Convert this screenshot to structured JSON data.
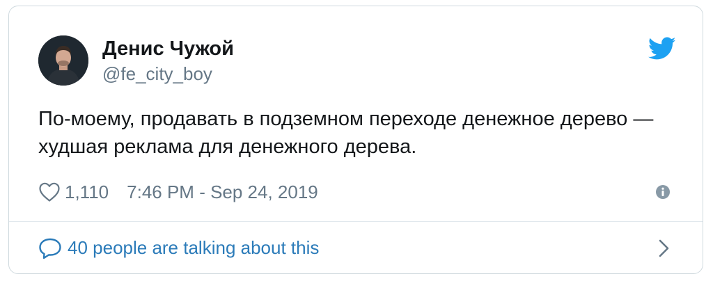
{
  "tweet": {
    "author": {
      "name": "Денис Чужой",
      "handle": "@fe_city_boy",
      "avatar": "avatar-photo"
    },
    "text": "По-моему, продавать в подземном переходе денежное дерево — худшая реклама для денежного дерева.",
    "likes": "1,110",
    "timestamp": "7:46 PM - Sep 24, 2019",
    "conversation": "40 people are talking about this",
    "icons": {
      "brand": "twitter-bird-icon",
      "like": "heart-icon",
      "info": "info-icon",
      "reply": "chat-bubble-icon",
      "more": "chevron-right-icon"
    }
  },
  "colors": {
    "brand": "#1da1f2",
    "link": "#2b7bb9",
    "secondary_text": "#657786",
    "primary_text": "#14171a",
    "border": "#cfd9de"
  }
}
